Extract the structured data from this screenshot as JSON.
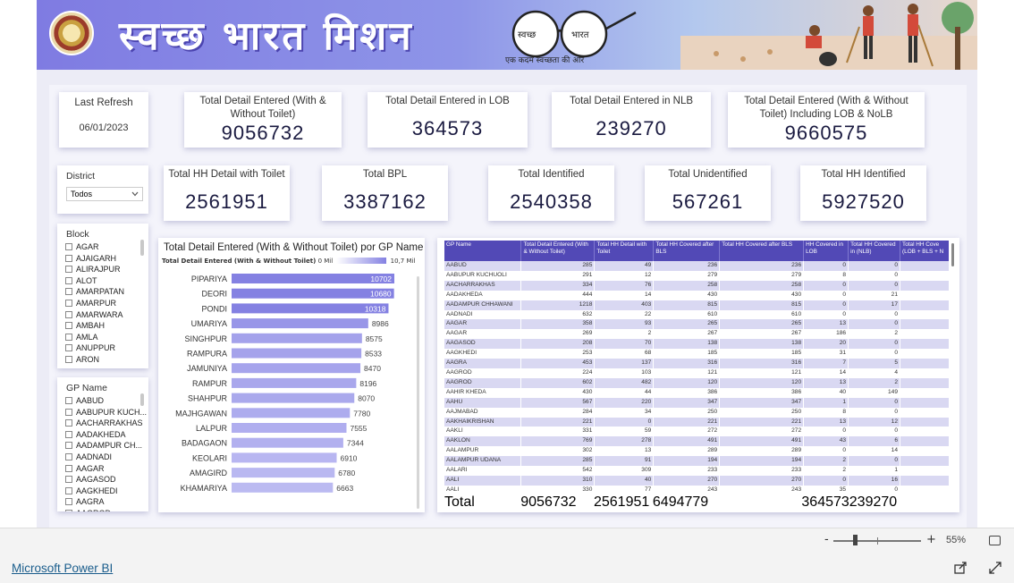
{
  "banner": {
    "title": "स्वच्छ भारत मिशन",
    "logo_left": "स्वच्छ",
    "logo_right": "भारत",
    "tagline": "एक कदम स्वच्छता की ओर"
  },
  "cards": {
    "last_refresh": {
      "label": "Last Refresh",
      "value": "06/01/2023"
    },
    "total_detail": {
      "label": "Total Detail Entered (With & Without Toilet)",
      "value": "9056732"
    },
    "lob": {
      "label": "Total Detail Entered in LOB",
      "value": "364573"
    },
    "nlb": {
      "label": "Total Detail Entered in NLB",
      "value": "239270"
    },
    "incl": {
      "label": "Total Detail Entered (With & Without Toilet) Including LOB & NoLB",
      "value": "9660575"
    },
    "hh_toilet": {
      "label": "Total HH Detail with Toilet",
      "value": "2561951"
    },
    "bpl": {
      "label": "Total BPL",
      "value": "3387162"
    },
    "identified": {
      "label": "Total Identified",
      "value": "2540358"
    },
    "unidentified": {
      "label": "Total Unidentified",
      "value": "567261"
    },
    "hh_identified": {
      "label": "Total HH Identified",
      "value": "5927520"
    }
  },
  "district": {
    "title": "District",
    "value": "Todos"
  },
  "block": {
    "title": "Block",
    "items": [
      "AGAR",
      "AJAIGARH",
      "ALIRAJPUR",
      "ALOT",
      "AMARPATAN",
      "AMARPUR",
      "AMARWARA",
      "AMBAH",
      "AMLA",
      "ANUPPUR",
      "ARON"
    ]
  },
  "gp": {
    "title": "GP Name",
    "items": [
      "AABUD",
      "AABUPUR KUCH...",
      "AACHARRAKHAS",
      "AADAKHEDA",
      "AADAMPUR CH...",
      "AADNADI",
      "AAGAR",
      "AAGASOD",
      "AAGKHEDI",
      "AAGRA",
      "AAGROD"
    ]
  },
  "chart_data": {
    "type": "bar",
    "title": "Total Detail Entered (With & Without Toilet) por GP Name",
    "legend": {
      "label": "Total Detail Entered (With & Without Toilet)",
      "min": "0 Mil",
      "max": "10,7 Mil"
    },
    "categories": [
      "PIPARIYA",
      "DEORI",
      "PONDI",
      "UMARIYA",
      "SINGHPUR",
      "RAMPURA",
      "JAMUNIYA",
      "RAMPUR",
      "SHAHPUR",
      "MAJHGAWAN",
      "LALPUR",
      "BADAGAON",
      "KEOLARI",
      "AMAGIRD",
      "KHAMARIYA"
    ],
    "values": [
      10702,
      10680,
      10318,
      8986,
      8575,
      8533,
      8470,
      8196,
      8070,
      7780,
      7555,
      7344,
      6910,
      6780,
      6663
    ],
    "colors": [
      "#8481e2",
      "#8481e2",
      "#8481e2",
      "#9896e8",
      "#a4a2eb",
      "#a5a3eb",
      "#a6a4ec",
      "#a9a7ec",
      "#aaa9ec",
      "#adacee",
      "#b0aeef",
      "#b2b0ef",
      "#b8b6f1",
      "#b9b8f1",
      "#bbbaf1"
    ],
    "orientation": "horizontal"
  },
  "table": {
    "headers": [
      "GP Name",
      "Total Detail Entered (With & Without Toilet)",
      "Total HH Detail with Toilet",
      "Total HH Covered after BLS",
      "Total HH Covered after BLS",
      "HH Covered in LOB",
      "Total HH Covered in (NLB)",
      "Total HH Cove (LOB + BLS + N"
    ],
    "rows": [
      [
        "AABUD",
        "285",
        "49",
        "236",
        "236",
        "0",
        "0"
      ],
      [
        "AABUPUR KUCHUOLI",
        "291",
        "12",
        "279",
        "279",
        "8",
        "0"
      ],
      [
        "AACHARRAKHAS",
        "334",
        "76",
        "258",
        "258",
        "0",
        "0"
      ],
      [
        "AADAKHEDA",
        "444",
        "14",
        "430",
        "430",
        "0",
        "21"
      ],
      [
        "AADAMPUR CHHAWANI",
        "1218",
        "403",
        "815",
        "815",
        "0",
        "17"
      ],
      [
        "AADNADI",
        "632",
        "22",
        "610",
        "610",
        "0",
        "0"
      ],
      [
        "AAGAR",
        "358",
        "93",
        "265",
        "265",
        "13",
        "0"
      ],
      [
        "AAGAR",
        "269",
        "2",
        "267",
        "267",
        "186",
        "2"
      ],
      [
        "AAGASOD",
        "208",
        "70",
        "138",
        "138",
        "20",
        "0"
      ],
      [
        "AAGKHEDI",
        "253",
        "68",
        "185",
        "185",
        "31",
        "0"
      ],
      [
        "AAGRA",
        "453",
        "137",
        "316",
        "316",
        "7",
        "5"
      ],
      [
        "AAGROD",
        "224",
        "103",
        "121",
        "121",
        "14",
        "4"
      ],
      [
        "AAGROD",
        "602",
        "482",
        "120",
        "120",
        "13",
        "2"
      ],
      [
        "AAHIR KHEDA",
        "430",
        "44",
        "386",
        "386",
        "40",
        "149"
      ],
      [
        "AAHU",
        "567",
        "220",
        "347",
        "347",
        "1",
        "0"
      ],
      [
        "AAJMABAD",
        "284",
        "34",
        "250",
        "250",
        "8",
        "0"
      ],
      [
        "AAKHAIKRISHAN",
        "221",
        "0",
        "221",
        "221",
        "13",
        "12"
      ],
      [
        "AAKLI",
        "331",
        "59",
        "272",
        "272",
        "0",
        "0"
      ],
      [
        "AAKLON",
        "769",
        "278",
        "491",
        "491",
        "43",
        "6"
      ],
      [
        "AALAMPUR",
        "302",
        "13",
        "289",
        "289",
        "0",
        "14"
      ],
      [
        "AALAMPUR UDANA",
        "285",
        "91",
        "194",
        "194",
        "2",
        "0"
      ],
      [
        "AALARI",
        "542",
        "309",
        "233",
        "233",
        "2",
        "1"
      ],
      [
        "AALI",
        "310",
        "40",
        "270",
        "270",
        "0",
        "16"
      ],
      [
        "AALI",
        "330",
        "77",
        "243",
        "243",
        "35",
        "0"
      ]
    ],
    "total": [
      "Total",
      "9056732",
      "2561951",
      "6494779",
      "",
      "364573",
      "239270"
    ]
  },
  "footer": {
    "zoom": "55%",
    "zoom_minus": "-",
    "zoom_plus": "+",
    "link": "Microsoft Power BI"
  }
}
